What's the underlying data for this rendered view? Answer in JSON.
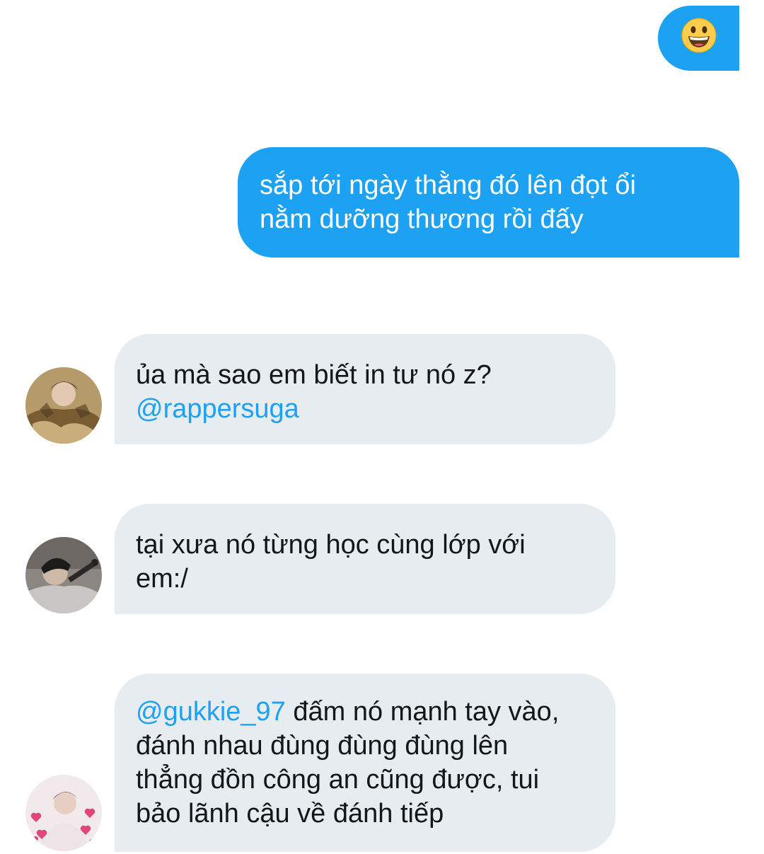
{
  "messages": [
    {
      "id": "m1",
      "direction": "outgoing",
      "type": "emoji",
      "emoji": "smiley-face-icon"
    },
    {
      "id": "m2",
      "direction": "outgoing",
      "type": "text",
      "lines": [
        "sắp tới ngày thằng đó lên đọt ổi",
        "nằm dưỡng thương rồi đấy"
      ]
    },
    {
      "id": "m3",
      "direction": "incoming",
      "type": "text",
      "avatar": "avatar-user-1",
      "line1": "ủa mà sao em biết in tư nó z?",
      "mention": "@rappersuga"
    },
    {
      "id": "m4",
      "direction": "incoming",
      "type": "text",
      "avatar": "avatar-user-2",
      "lines": [
        "tại xưa nó từng học cùng lớp với",
        "em:/"
      ]
    },
    {
      "id": "m5",
      "direction": "incoming",
      "type": "text",
      "avatar": "avatar-user-3",
      "mention": "@gukkie_97",
      "line1_rest": " đấm nó mạnh tay vào,",
      "lines_rest": [
        "đánh nhau đùng đùng đùng lên",
        "thẳng đồn công an cũng được, tui",
        "bảo lãnh cậu về đánh tiếp"
      ]
    }
  ],
  "colors": {
    "outgoing_bubble": "#1da1f2",
    "incoming_bubble": "#e6ecf0",
    "mention": "#1da1f2",
    "incoming_text": "#14171a",
    "outgoing_text": "#ffffff"
  }
}
